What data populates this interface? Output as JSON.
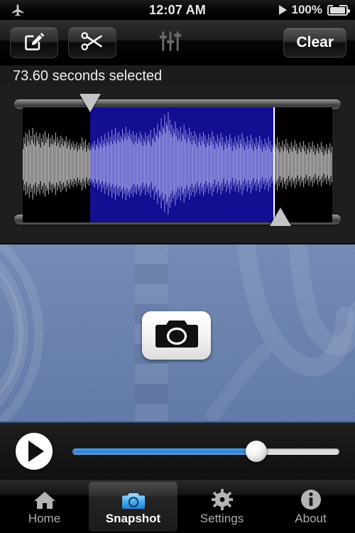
{
  "statusbar": {
    "airplane_icon": "airplane-icon",
    "time": "12:07 AM",
    "play_icon": "play-indicator-icon",
    "battery_percent": "100%",
    "battery_icon": "battery-charging-icon"
  },
  "toolbar": {
    "compose_icon": "compose-icon",
    "cut_icon": "scissors-icon",
    "equalizer_icon": "equalizer-sliders-icon",
    "clear_label": "Clear"
  },
  "selection": {
    "status_text": "73.60 seconds selected",
    "seconds": 73.6,
    "start_pct": 21.8,
    "end_pct": 81.7,
    "playhead_pct": 81.0,
    "top_handle_pct": 21.8,
    "bottom_handle_pct": 83.3
  },
  "waveform": {
    "unselected_color": "#b0b0b0",
    "selected_color": "#8f8fe0",
    "selection_fill": "#130f93",
    "background_color": "#000000",
    "playhead_color": "#ffffff",
    "samples": [
      0.3,
      0.52,
      0.4,
      0.61,
      0.35,
      0.58,
      0.44,
      0.66,
      0.38,
      0.55,
      0.47,
      0.7,
      0.41,
      0.57,
      0.36,
      0.62,
      0.45,
      0.54,
      0.39,
      0.6,
      0.33,
      0.5,
      0.43,
      0.58,
      0.37,
      0.64,
      0.42,
      0.53,
      0.48,
      0.59,
      0.34,
      0.51,
      0.4,
      0.56,
      0.38,
      0.49,
      0.44,
      0.61,
      0.36,
      0.52,
      0.41,
      0.47,
      0.33,
      0.55,
      0.39,
      0.5,
      0.35,
      0.46,
      0.42,
      0.54,
      0.31,
      0.44,
      0.37,
      0.48,
      0.29,
      0.41,
      0.34,
      0.45,
      0.28,
      0.39,
      0.32,
      0.43,
      0.26,
      0.37,
      0.3,
      0.41,
      0.35,
      0.52,
      0.28,
      0.44,
      0.33,
      0.48,
      0.25,
      0.38,
      0.31,
      0.42,
      0.27,
      0.36,
      0.3,
      0.4,
      0.34,
      0.46,
      0.29,
      0.39,
      0.36,
      0.5,
      0.31,
      0.43,
      0.38,
      0.55,
      0.33,
      0.47,
      0.4,
      0.58,
      0.35,
      0.49,
      0.42,
      0.62,
      0.37,
      0.53,
      0.44,
      0.66,
      0.39,
      0.57,
      0.46,
      0.7,
      0.41,
      0.6,
      0.48,
      0.63,
      0.43,
      0.55,
      0.5,
      0.68,
      0.45,
      0.59,
      0.52,
      0.72,
      0.47,
      0.61,
      0.54,
      0.66,
      0.49,
      0.58,
      0.43,
      0.64,
      0.38,
      0.56,
      0.45,
      0.6,
      0.4,
      0.52,
      0.47,
      0.63,
      0.42,
      0.57,
      0.36,
      0.5,
      0.44,
      0.61,
      0.38,
      0.54,
      0.46,
      0.58,
      0.41,
      0.66,
      0.35,
      0.52,
      0.48,
      0.7,
      0.43,
      0.6,
      0.55,
      0.78,
      0.5,
      0.66,
      0.62,
      0.88,
      0.56,
      0.72,
      0.68,
      0.95,
      0.6,
      0.8,
      0.74,
      1.0,
      0.65,
      0.86,
      0.58,
      0.76,
      0.52,
      0.68,
      0.6,
      0.82,
      0.54,
      0.7,
      0.46,
      0.64,
      0.5,
      0.72,
      0.44,
      0.6,
      0.56,
      0.76,
      0.48,
      0.66,
      0.42,
      0.58,
      0.5,
      0.7,
      0.44,
      0.62,
      0.38,
      0.55,
      0.46,
      0.64,
      0.4,
      0.57,
      0.34,
      0.5,
      0.43,
      0.6,
      0.37,
      0.53,
      0.45,
      0.62,
      0.39,
      0.56,
      0.33,
      0.48,
      0.41,
      0.58,
      0.36,
      0.51,
      0.44,
      0.63,
      0.38,
      0.54,
      0.3,
      0.46,
      0.4,
      0.57,
      0.34,
      0.49,
      0.42,
      0.6,
      0.36,
      0.52,
      0.28,
      0.44,
      0.38,
      0.55,
      0.32,
      0.47,
      0.4,
      0.58,
      0.34,
      0.5,
      0.26,
      0.42,
      0.36,
      0.53,
      0.3,
      0.45,
      0.38,
      0.56,
      0.32,
      0.48,
      0.4,
      0.6,
      0.34,
      0.51,
      0.28,
      0.43,
      0.37,
      0.54,
      0.31,
      0.46,
      0.39,
      0.57,
      0.33,
      0.49,
      0.27,
      0.41,
      0.35,
      0.52,
      0.29,
      0.44,
      0.37,
      0.55,
      0.31,
      0.47,
      0.25,
      0.39,
      0.33,
      0.5,
      0.28,
      0.42,
      0.36,
      0.53,
      0.3,
      0.45,
      0.24,
      0.38,
      0.32,
      0.48,
      0.27,
      0.4,
      0.34,
      0.51,
      0.29,
      0.43,
      0.23,
      0.36,
      0.31,
      0.46,
      0.26,
      0.39,
      0.33,
      0.49,
      0.28,
      0.41,
      0.22,
      0.35,
      0.3,
      0.44,
      0.25,
      0.37,
      0.32,
      0.47,
      0.27,
      0.4,
      0.21,
      0.34,
      0.29,
      0.43,
      0.24,
      0.36,
      0.31,
      0.45,
      0.26,
      0.38,
      0.2,
      0.33,
      0.28,
      0.42,
      0.23,
      0.35,
      0.3,
      0.44,
      0.25,
      0.37,
      0.19,
      0.32,
      0.27,
      0.4,
      0.22,
      0.34,
      0.29,
      0.43,
      0.24,
      0.36,
      0.18,
      0.31,
      0.26,
      0.39,
      0.21,
      0.33,
      0.28,
      0.41,
      0.23,
      0.35
    ]
  },
  "camera_panel": {
    "camera_icon": "camera-icon",
    "background_color": "#6981ad"
  },
  "transport": {
    "play_icon": "play-icon",
    "slider_value_pct": 69,
    "slider_fill_color": "#2a7fd4"
  },
  "tabbar": {
    "items": [
      {
        "label": "Home",
        "icon": "home-icon",
        "active": false
      },
      {
        "label": "Snapshot",
        "icon": "camera-icon",
        "active": true
      },
      {
        "label": "Settings",
        "icon": "gear-icon",
        "active": false
      },
      {
        "label": "About",
        "icon": "info-icon",
        "active": false
      }
    ]
  }
}
